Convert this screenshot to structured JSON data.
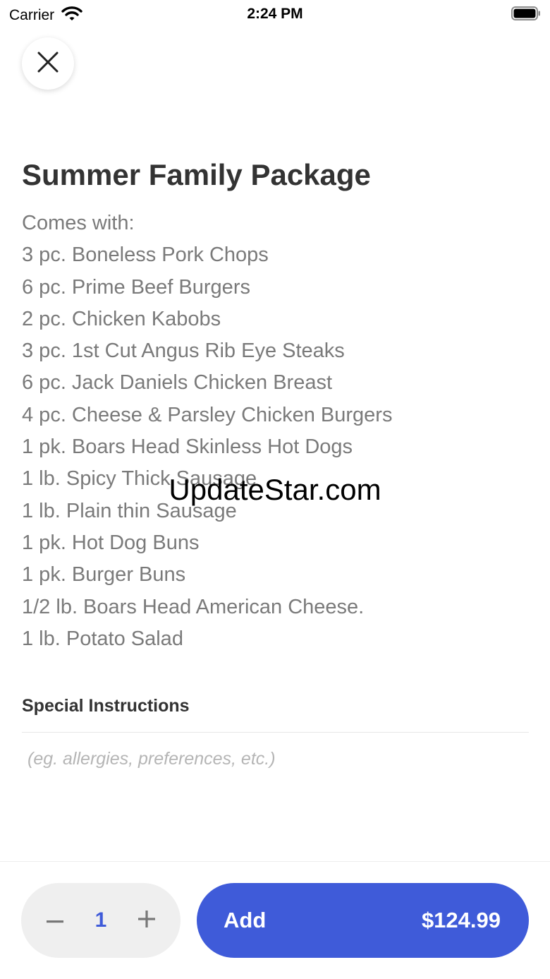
{
  "status_bar": {
    "carrier": "Carrier",
    "time": "2:24 PM"
  },
  "product": {
    "title": "Summer Family Package",
    "description_lines": [
      "Comes with:",
      "3 pc. Boneless Pork Chops",
      "6 pc. Prime Beef Burgers",
      "2 pc. Chicken Kabobs",
      "3 pc. 1st Cut Angus Rib Eye Steaks",
      "6 pc. Jack Daniels Chicken Breast",
      "4 pc. Cheese & Parsley Chicken Burgers",
      "1 pk. Boars Head Skinless Hot Dogs",
      "1 lb. Spicy Thick Sausage",
      "1 lb. Plain thin Sausage",
      "1 pk. Hot Dog Buns",
      "1 pk. Burger Buns",
      "1/2 lb. Boars Head American Cheese.",
      "1 lb. Potato Salad"
    ]
  },
  "watermark": "UpdateStar.com",
  "special_instructions": {
    "label": "Special Instructions",
    "value": "",
    "placeholder": "(eg. allergies, preferences, etc.)"
  },
  "footer": {
    "quantity": "1",
    "add_label": "Add",
    "price": "$124.99"
  },
  "colors": {
    "accent": "#3f5bd9",
    "stepper_bg": "#efefef",
    "title_text": "#333333",
    "body_text": "#7a7a7a"
  },
  "icons": {
    "close": "close-icon",
    "wifi": "wifi-icon",
    "battery": "battery-icon",
    "minus": "minus-icon",
    "plus": "plus-icon"
  }
}
